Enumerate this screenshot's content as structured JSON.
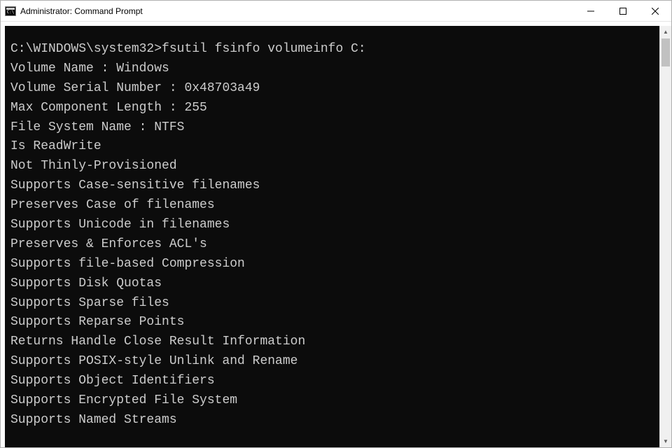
{
  "window": {
    "title": "Administrator: Command Prompt"
  },
  "terminal": {
    "prompt": "C:\\WINDOWS\\system32>",
    "command": "fsutil fsinfo volumeinfo C:",
    "lines": [
      "Volume Name : Windows",
      "Volume Serial Number : 0x48703a49",
      "Max Component Length : 255",
      "File System Name : NTFS",
      "Is ReadWrite",
      "Not Thinly-Provisioned",
      "Supports Case-sensitive filenames",
      "Preserves Case of filenames",
      "Supports Unicode in filenames",
      "Preserves & Enforces ACL's",
      "Supports file-based Compression",
      "Supports Disk Quotas",
      "Supports Sparse files",
      "Supports Reparse Points",
      "Returns Handle Close Result Information",
      "Supports POSIX-style Unlink and Rename",
      "Supports Object Identifiers",
      "Supports Encrypted File System",
      "Supports Named Streams"
    ]
  }
}
